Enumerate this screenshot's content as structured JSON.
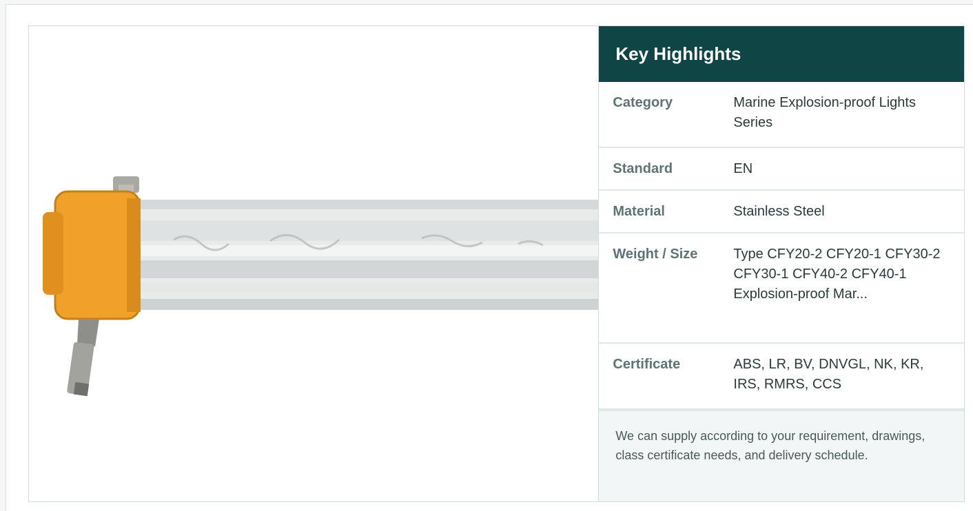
{
  "highlights": {
    "title": "Key Highlights",
    "rows": [
      {
        "label": "Category",
        "value": "Marine Explosion-proof Lights Series"
      },
      {
        "label": "Standard",
        "value": "EN"
      },
      {
        "label": "Material",
        "value": "Stainless Steel"
      },
      {
        "label": "Weight / Size",
        "value": "Type CFY20-2 CFY20-1 CFY30-2 CFY30-1 CFY40-2 CFY40-1 Explosion-proof Mar..."
      },
      {
        "label": "Certificate",
        "value": "ABS, LR, BV, DNVGL, NK, KR, IRS, RMRS, CCS"
      }
    ],
    "note": "We can supply according to your requirement, drawings, class certificate needs, and delivery schedule."
  },
  "colors": {
    "header_bg": "#0f4544",
    "lamp_cap": "#f0a12a",
    "tube": "#e4e6e6"
  }
}
